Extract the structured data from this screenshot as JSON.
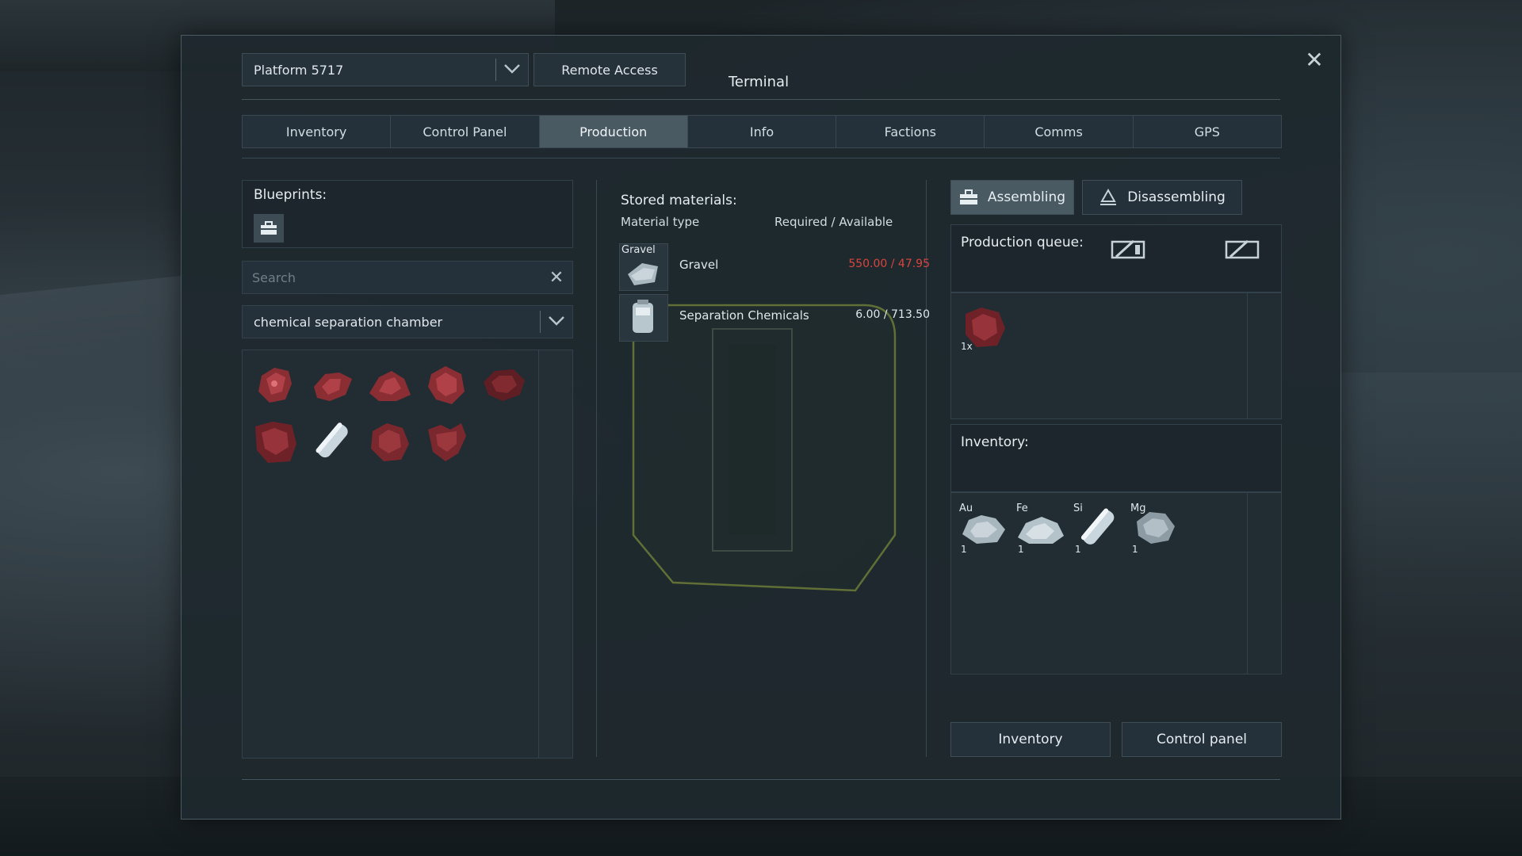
{
  "header": {
    "grid_select": "Platform 5717",
    "remote_access": "Remote Access",
    "title": "Terminal"
  },
  "tabs": [
    {
      "label": "Inventory",
      "active": false
    },
    {
      "label": "Control Panel",
      "active": false
    },
    {
      "label": "Production",
      "active": true
    },
    {
      "label": "Info",
      "active": false
    },
    {
      "label": "Factions",
      "active": false
    },
    {
      "label": "Comms",
      "active": false
    },
    {
      "label": "GPS",
      "active": false
    }
  ],
  "blueprints": {
    "title": "Blueprints:",
    "search_placeholder": "Search",
    "category": "chemical separation chamber",
    "items": [
      "ore-red-icon",
      "ore-red-icon",
      "ore-red-icon",
      "ore-red-icon",
      "ore-red-icon",
      "ore-red-icon",
      "canister-icon",
      "ore-red-icon",
      "ore-red-icon"
    ]
  },
  "stored": {
    "title": "Stored materials:",
    "col_type": "Material type",
    "col_req": "Required / Available",
    "rows": [
      {
        "icon_label": "Gravel",
        "name": "Gravel",
        "value": "550.00 / 47.95",
        "insufficient": true
      },
      {
        "icon_label": "",
        "name": "Separation Chemicals",
        "value": "6.00 / 713.50",
        "insufficient": false
      }
    ]
  },
  "modes": {
    "assembling": "Assembling",
    "disassembling": "Disassembling"
  },
  "queue": {
    "title": "Production queue:",
    "items": [
      {
        "count": "1x"
      }
    ]
  },
  "inventory": {
    "title": "Inventory:",
    "items": [
      {
        "symbol": "Au",
        "count": "1"
      },
      {
        "symbol": "Fe",
        "count": "1"
      },
      {
        "symbol": "Si",
        "count": "1"
      },
      {
        "symbol": "Mg",
        "count": "1"
      }
    ]
  },
  "footer": {
    "inventory_btn": "Inventory",
    "control_panel_btn": "Control panel"
  },
  "colors": {
    "accent_active": "#4a5a63",
    "insufficient": "#d9443f",
    "hologram": "#8a9a3a"
  }
}
